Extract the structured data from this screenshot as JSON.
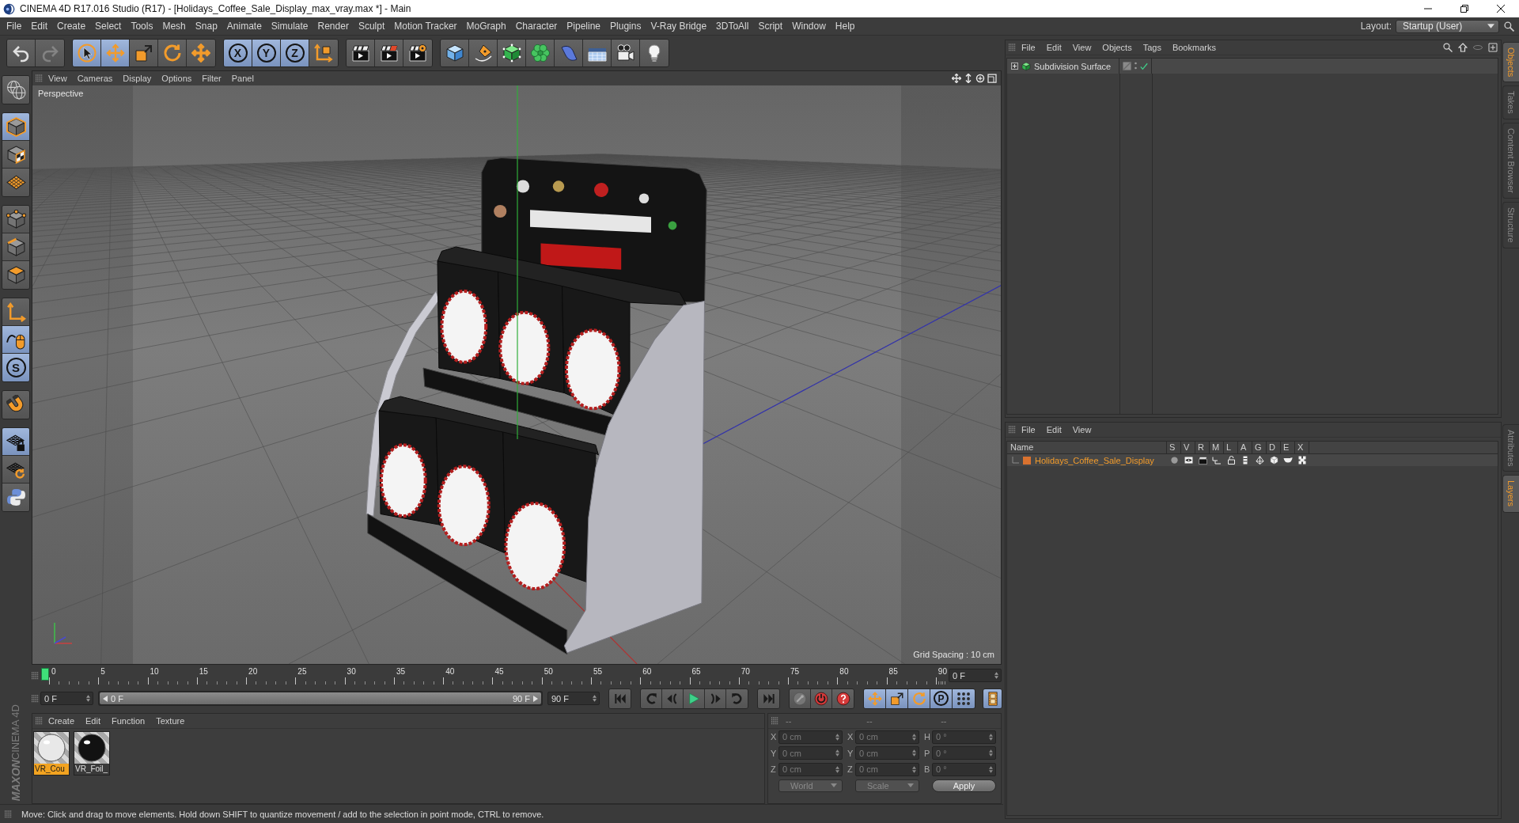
{
  "window": {
    "title": "CINEMA 4D R17.016 Studio (R17) - [Holidays_Coffee_Sale_Display_max_vray.max *] - Main"
  },
  "menu_bar": [
    "File",
    "Edit",
    "Create",
    "Select",
    "Tools",
    "Mesh",
    "Snap",
    "Animate",
    "Simulate",
    "Render",
    "Sculpt",
    "Motion Tracker",
    "MoGraph",
    "Character",
    "Pipeline",
    "Plugins",
    "V-Ray Bridge",
    "3DToAll",
    "Script",
    "Window",
    "Help"
  ],
  "layout": {
    "label": "Layout:",
    "value": "Startup (User)"
  },
  "toolbar": [
    [
      {
        "active": false,
        "disabled": false
      },
      {
        "active": false,
        "disabled": true
      }
    ],
    [
      {
        "active": true,
        "disabled": false
      },
      {
        "active": true,
        "disabled": false
      },
      {
        "active": false,
        "disabled": false
      },
      {
        "active": false,
        "disabled": false
      },
      {
        "active": false,
        "disabled": false
      }
    ],
    [
      {
        "label": "X",
        "active": true,
        "disabled": false
      },
      {
        "label": "Y",
        "active": true,
        "disabled": false
      },
      {
        "label": "Z",
        "active": true,
        "disabled": false
      },
      {
        "active": false,
        "disabled": false
      }
    ],
    [
      {
        "active": false,
        "disabled": false
      },
      {
        "active": false,
        "disabled": false
      },
      {
        "active": false,
        "disabled": false
      }
    ],
    [
      {
        "active": false,
        "disabled": false
      },
      {
        "active": false,
        "disabled": false
      },
      {
        "active": false,
        "disabled": false
      },
      {
        "active": false,
        "disabled": false
      },
      {
        "active": false,
        "disabled": false
      },
      {
        "active": false,
        "disabled": false
      },
      {
        "active": false,
        "disabled": false
      },
      {
        "active": false,
        "disabled": false
      }
    ]
  ],
  "tool_palette": [
    [
      {
        "active": false
      }
    ],
    [
      {
        "active": true
      },
      {
        "active": false
      },
      {
        "active": false
      }
    ],
    [
      {
        "active": false
      },
      {
        "active": false
      },
      {
        "active": false
      }
    ],
    [
      {
        "active": false
      },
      {
        "active": true
      },
      {
        "label": "S",
        "active": true
      }
    ],
    [
      {
        "active": false
      }
    ],
    [
      {
        "active": true
      },
      {
        "active": false
      },
      {
        "active": false
      }
    ]
  ],
  "viewport": {
    "menu": [
      "View",
      "Cameras",
      "Display",
      "Options",
      "Filter",
      "Panel"
    ],
    "camera": "Perspective",
    "grid_spacing": "Grid Spacing : 10 cm"
  },
  "timeline": {
    "ticks": [
      "0",
      "5",
      "10",
      "15",
      "20",
      "25",
      "30",
      "35",
      "40",
      "45",
      "50",
      "55",
      "60",
      "65",
      "70",
      "75",
      "80",
      "85",
      "90"
    ],
    "playhead": {
      "level": 0
    },
    "current_frame": "0 F"
  },
  "transport": {
    "start": "0 F",
    "range": {
      "start": "0 F",
      "end": "90 F",
      "level": 1
    },
    "end": "90 F",
    "modes": [
      {
        "active": true
      },
      {
        "active": true
      },
      {
        "active": true
      },
      {
        "label": "P",
        "active": true
      },
      {
        "active": true
      }
    ],
    "timeline_toggle": {
      "active": true
    }
  },
  "materials": {
    "menu": [
      "Create",
      "Edit",
      "Function",
      "Texture"
    ],
    "items": [
      {
        "name": "VR_Cou",
        "color": "#e8e8e8",
        "selected": true
      },
      {
        "name": "VR_Foil_",
        "color": "#121212",
        "selected": false
      }
    ]
  },
  "coordinates": {
    "headers": [
      "--",
      "--",
      "--"
    ],
    "rows": [
      [
        {
          "axis": "X",
          "value": "0 cm"
        },
        {
          "axis": "X",
          "value": "0 cm"
        },
        {
          "axis": "H",
          "value": "0 °"
        }
      ],
      [
        {
          "axis": "Y",
          "value": "0 cm"
        },
        {
          "axis": "Y",
          "value": "0 cm"
        },
        {
          "axis": "P",
          "value": "0 °"
        }
      ],
      [
        {
          "axis": "Z",
          "value": "0 cm"
        },
        {
          "axis": "Z",
          "value": "0 cm"
        },
        {
          "axis": "B",
          "value": "0 °"
        }
      ]
    ],
    "dropdowns": [
      "World",
      "Scale"
    ],
    "apply": "Apply"
  },
  "brand": {
    "vendor": "MAXON",
    "product": "CINEMA 4D"
  },
  "status_bar": "Move: Click and drag to move elements. Hold down SHIFT to quantize movement / add to the selection in point mode, CTRL to remove.",
  "object_manager": {
    "menu": [
      "File",
      "Edit",
      "View",
      "Objects",
      "Tags",
      "Bookmarks"
    ],
    "objects": [
      {
        "name": "Subdivision Surface",
        "expanded": false,
        "selected": false
      }
    ]
  },
  "layer_manager": {
    "menu": [
      "File",
      "Edit",
      "View"
    ],
    "columns": [
      "Name",
      "S",
      "V",
      "R",
      "M",
      "L",
      "A",
      "G",
      "D",
      "E",
      "X"
    ],
    "layers": [
      {
        "name": "Holidays_Coffee_Sale_Display",
        "color": "#d9722f",
        "selected": true,
        "toggles": [
          {
            "on": false
          },
          {
            "on": true
          },
          {
            "on": true
          },
          {
            "on": true
          },
          {
            "on": false
          },
          {
            "on": true
          },
          {
            "on": true
          },
          {
            "on": true
          },
          {
            "on": true
          },
          {
            "on": true
          }
        ]
      }
    ]
  },
  "side_tabs": {
    "upper": [
      {
        "label": "Objects",
        "selected": true
      },
      {
        "label": "Takes",
        "selected": false
      },
      {
        "label": "Content Browser",
        "selected": false
      },
      {
        "label": "Structure",
        "selected": false
      }
    ],
    "lower": [
      {
        "label": "Attributes",
        "selected": false
      },
      {
        "label": "Layers",
        "selected": true
      }
    ]
  }
}
